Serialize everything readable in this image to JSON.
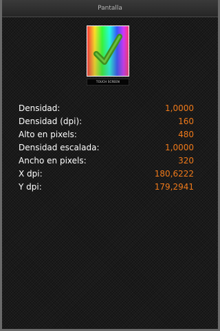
{
  "window": {
    "title": "Pantalla"
  },
  "icon": {
    "name": "touch-screen-check-icon",
    "label": "TOUCH SCREEN",
    "check_color": "#3f8f1d"
  },
  "colors": {
    "value_text": "#f07a1a",
    "label_text": "#ffffff"
  },
  "rows": [
    {
      "label": "Densidad:",
      "value": "1,0000"
    },
    {
      "label": "Densidad (dpi):",
      "value": "160"
    },
    {
      "label": "Alto en pixels:",
      "value": "480"
    },
    {
      "label": "Densidad escalada:",
      "value": "1,0000"
    },
    {
      "label": "Ancho en pixels:",
      "value": "320"
    },
    {
      "label": "X dpi:",
      "value": "180,6222"
    },
    {
      "label": "Y dpi:",
      "value": "179,2941"
    }
  ]
}
